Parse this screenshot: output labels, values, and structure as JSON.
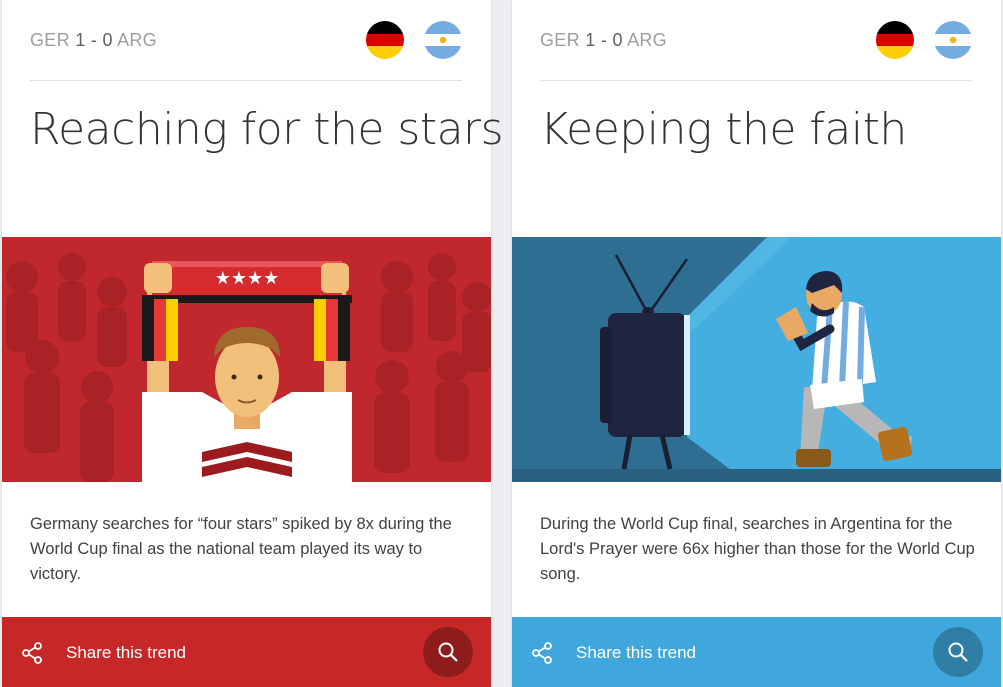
{
  "cards": [
    {
      "score": {
        "home": "GER",
        "home_goals": "1",
        "separator": " - ",
        "away_goals": "0",
        "away": "ARG"
      },
      "title": "Reaching for the stars",
      "description": "Germany searches for “four stars” spiked by 8x during the World Cup final as the national team played its way to victory.",
      "illustration_text": "★★★★",
      "share_label": "Share this trend",
      "accent": "#c62828",
      "button_color": "#8e1c1c",
      "icons": {
        "share": "share-icon",
        "search": "search-icon"
      }
    },
    {
      "score": {
        "home": "GER",
        "home_goals": "1",
        "separator": " - ",
        "away_goals": "0",
        "away": "ARG"
      },
      "title": "Keeping the faith",
      "description": "During the World Cup final, searches in Argentina for the Lord's Prayer were 66x higher than those for the World Cup song.",
      "share_label": "Share this trend",
      "accent": "#3fa7dc",
      "button_color": "#2e7ea6",
      "icons": {
        "share": "share-icon",
        "search": "search-icon"
      }
    }
  ],
  "flags": {
    "germany": [
      "#000000",
      "#dd0000",
      "#ffce00"
    ],
    "argentina": [
      "#74acdf",
      "#ffffff",
      "#f6b40e"
    ]
  }
}
